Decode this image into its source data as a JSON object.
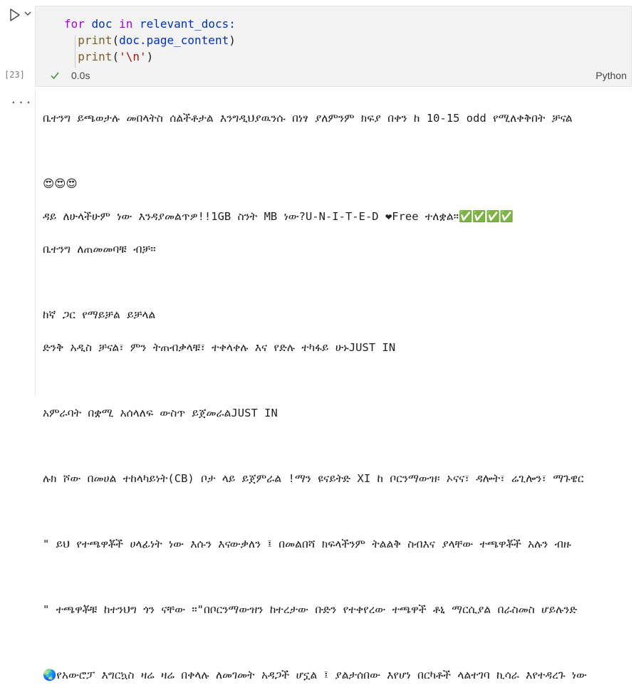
{
  "cell": {
    "exec_count": "[23]",
    "code": {
      "l1_kw_for": "for",
      "l1_var": "doc",
      "l1_kw_in": "in",
      "l1_iter": "relevant_docs:",
      "l2_fn": "print",
      "l2_open": "(",
      "l2_arg": "doc.page_content",
      "l2_close": ")",
      "l3_fn": "print",
      "l3_open": "(",
      "l3_str": "'\\n'",
      "l3_close": ")"
    },
    "status_time": "0.0s",
    "language": "Python"
  },
  "output": {
    "dots": "...",
    "lines": [
      "ቤተንግ ይጫወታሉ መበላትስ ሰልችቶታል እንግዲህያዉንሱ በነፃ ያለምንም ክፍያ በቀን ከ 10-15 odd የሚለቀቅበት ቻናል",
      "",
      "😍😍😍",
      "ዳይ ለሁላችሁም ነው እንዳያመልጥዎ!!1GB ስንት MB ነው?U-N-I-T-E-D ❤Free ተለቋል።✅✅✅✅",
      "ቤተንግ ለጠመመባቹ ብቻ።",
      "",
      "ከኛ ጋር የማይቻል ይቻላል",
      "ድንቅ አዲስ ቻናል፣ ምን ትጠብቃላቹ፣ ተቀላቀሉ እና የድሉ ተካፋይ ሁኑJUST IN",
      "",
      "አምራባት በቋሚ አሰላለፍ ውስጥ ይጀመራልJUST IN",
      "",
      "ሉክ ሾው በመሀል ተከላካይነት(CB) ቦታ ላይ ይጀምራል !ማን ዩናይትድ XI ከ ቦርንማውዝ፡ ኦናና፣ ዳሎት፣ ሬጊሎን፣ ማጉዌር",
      "",
      "\" ይህ የተጫዋቾች ሀላፊነት ነው እሱን እናውቃለን ፤ በመልበሻ ክፍላችንም ትልልቅ ስብእና ያላቸው ተጫዋቾች አሉን ብዙ",
      "",
      "\" ተጫዋቾቹ ከተንህግ ጎን ናቸው ።\"በቦርንማውዝን ከተረታው ቡድን የተቀየረው ተጫዋች ቶኒ ማርሲያል በራስመስ ሆይሉንድ",
      "",
      "🌏የአውሮፓ እግርኳስ ዛሬ ዛሬ በቀላሉ ለመገመት አዳጋች ሆኗል ፤ ያልታሰበው እየሆነ በርካቶች ላልተገባ ኪሳራ እየተዳረጉ ነው"
    ]
  }
}
